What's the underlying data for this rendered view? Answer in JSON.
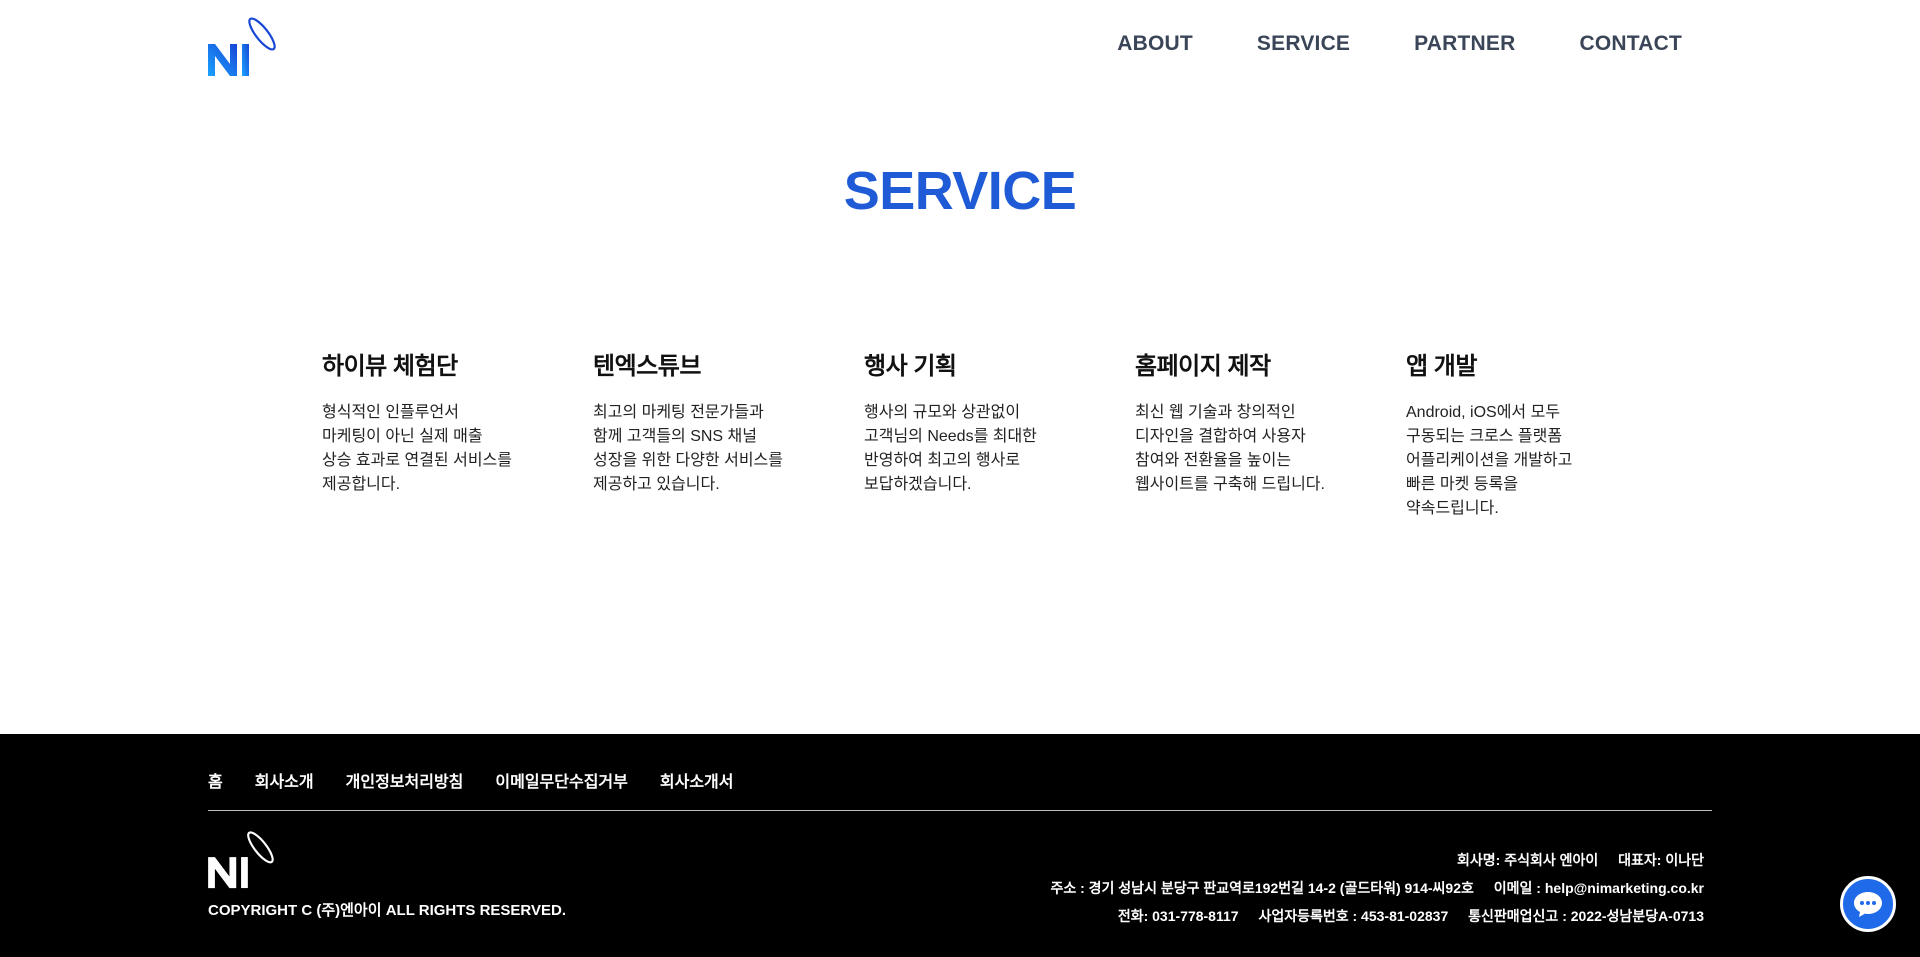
{
  "brand": {
    "logo_text": "NI",
    "accent_color": "#1f5bd6"
  },
  "nav": {
    "items": [
      {
        "label": "ABOUT"
      },
      {
        "label": "SERVICE"
      },
      {
        "label": "PARTNER"
      },
      {
        "label": "CONTACT"
      }
    ]
  },
  "main": {
    "title": "SERVICE",
    "services": [
      {
        "title": "하이뷰 체험단",
        "desc": "형식적인 인플루언서\n마케팅이 아닌 실제 매출\n상승 효과로 연결된 서비스를\n제공합니다."
      },
      {
        "title": "텐엑스튜브",
        "desc": "최고의 마케팅 전문가들과\n함께 고객들의 SNS 채널\n성장을 위한 다양한 서비스를\n제공하고 있습니다."
      },
      {
        "title": "행사 기획",
        "desc": "행사의 규모와 상관없이\n고객님의 Needs를 최대한\n반영하여 최고의 행사로\n보답하겠습니다."
      },
      {
        "title": "홈페이지 제작",
        "desc": "최신 웹 기술과 창의적인\n디자인을 결합하여 사용자\n참여와 전환율을 높이는\n웹사이트를 구축해 드립니다."
      },
      {
        "title": "앱 개발",
        "desc": "Android, iOS에서 모두\n구동되는 크로스 플랫폼\n어플리케이션을 개발하고\n빠른 마켓 등록을\n약속드립니다."
      }
    ]
  },
  "footer": {
    "links": [
      {
        "label": "홈"
      },
      {
        "label": "회사소개"
      },
      {
        "label": "개인정보처리방침"
      },
      {
        "label": "이메일무단수집거부"
      },
      {
        "label": "회사소개서"
      }
    ],
    "copyright": "COPYRIGHT C (주)엔아이 ALL RIGHTS RESERVED.",
    "company_name": "회사명: 주식회사 엔아이",
    "ceo": "대표자: 이나단",
    "address": "주소 : 경기 성남시 분당구 판교역로192번길 14-2 (골드타워) 914-씨92호",
    "email": "이메일 : help@nimarketing.co.kr",
    "phone": "전화: 031-778-8117",
    "business_number": "사업자등록번호 : 453-81-02837",
    "ecommerce_number": "통신판매업신고 : 2022-성남분당A-0713"
  },
  "chat": {
    "icon": "chat-bubble-icon",
    "color": "#1f6ae8"
  }
}
